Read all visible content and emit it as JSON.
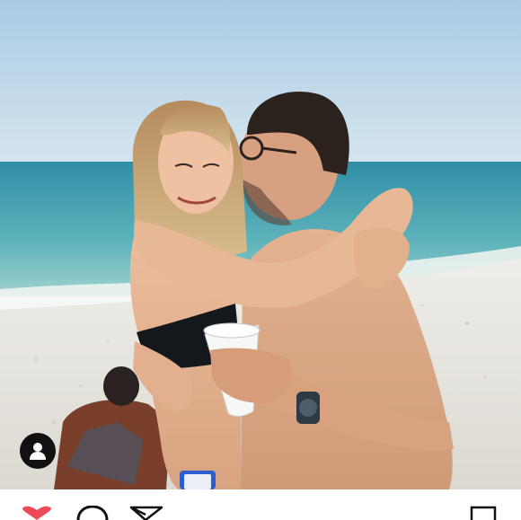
{
  "post": {
    "image": {
      "description_icon": "beach-photo",
      "colors": {
        "sky": "#b9d6ea",
        "sea": "#4fa7b5",
        "sand": "#e8e6e1"
      }
    },
    "tag_icon": "user-tag-icon",
    "actions": {
      "like_icon": "heart-icon",
      "like_color": "#ed4956",
      "comment_icon": "comment-icon",
      "share_icon": "paper-plane-icon",
      "save_icon": "bookmark-icon"
    }
  }
}
